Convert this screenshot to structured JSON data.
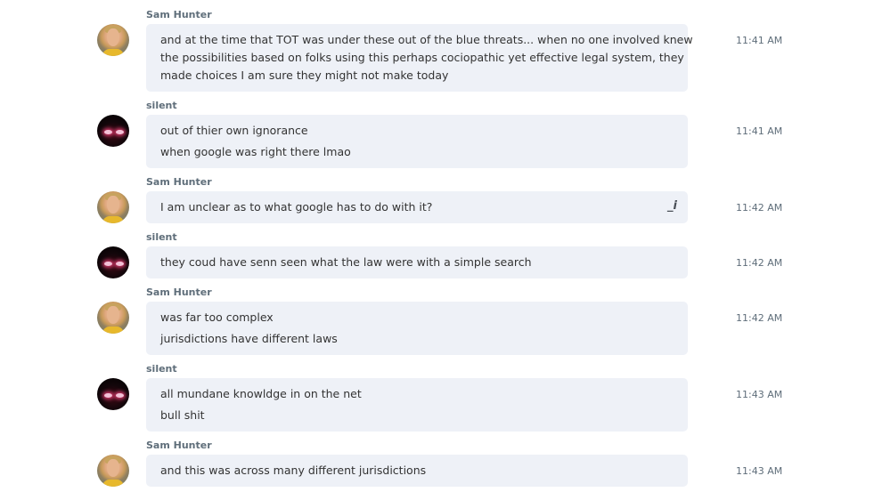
{
  "messages": [
    {
      "author": "Sam Hunter",
      "avatar": "sam-hunter-avatar",
      "lines": [
        "and at the time that TOT was under these out of the blue threats... when no one involved knew",
        "the possibilities based on folks using this perhaps cociopathic yet effective legal system, they",
        "made choices I am sure they might not make today"
      ],
      "time": "11:41 AM"
    },
    {
      "author": "silent",
      "avatar": "silent-avatar",
      "lines": [
        "out of thier own ignorance",
        "when google was right there lmao"
      ],
      "time": "11:41 AM"
    },
    {
      "author": "Sam Hunter",
      "avatar": "sam-hunter-avatar",
      "lines": [
        "I am unclear as to what google has to do with it?"
      ],
      "time": "11:42 AM",
      "edit_icon": "_i"
    },
    {
      "author": "silent",
      "avatar": "silent-avatar",
      "lines": [
        "they coud have senn seen what the law were with a simple search"
      ],
      "time": "11:42 AM"
    },
    {
      "author": "Sam Hunter",
      "avatar": "sam-hunter-avatar",
      "lines": [
        "was far too complex",
        "jurisdictions have different laws"
      ],
      "time": "11:42 AM"
    },
    {
      "author": "silent",
      "avatar": "silent-avatar",
      "lines": [
        "all mundane knowldge in on the net",
        "bull shit"
      ],
      "time": "11:43 AM"
    },
    {
      "author": "Sam Hunter",
      "avatar": "sam-hunter-avatar",
      "lines": [
        "and this was across many different jurisdictions"
      ],
      "time": "11:43 AM"
    }
  ]
}
